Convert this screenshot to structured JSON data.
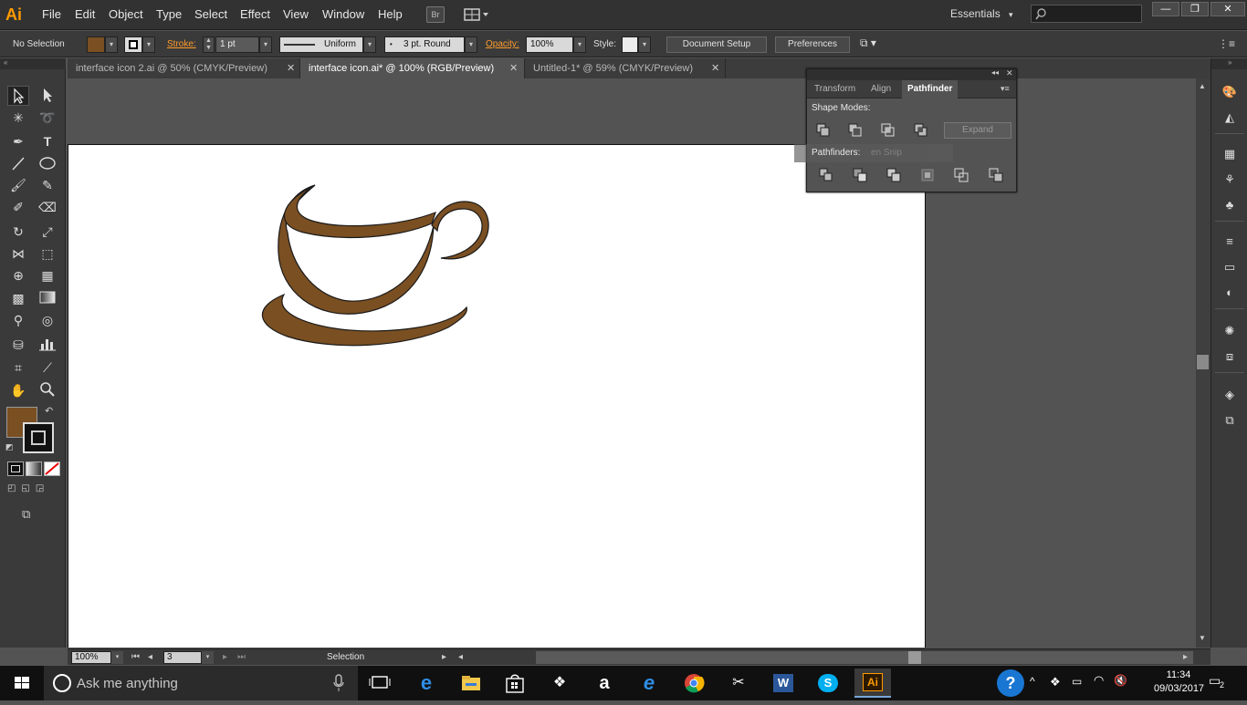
{
  "app": {
    "logo": "Ai"
  },
  "menu": [
    "File",
    "Edit",
    "Object",
    "Type",
    "Select",
    "Effect",
    "View",
    "Window",
    "Help"
  ],
  "bridge_label": "Br",
  "workspace": {
    "label": "Essentials",
    "arrow": "▾"
  },
  "window_controls": {
    "minimize": "—",
    "restore": "❐",
    "close": "✕"
  },
  "control_bar": {
    "selection": "No Selection",
    "fill_color": "#7a4f22",
    "stroke_label": "Stroke:",
    "stroke_weight": "1 pt",
    "profile": "Uniform",
    "brush": "3 pt. Round",
    "opacity_label": "Opacity:",
    "opacity": "100%",
    "style_label": "Style:",
    "document_setup": "Document Setup",
    "preferences": "Preferences"
  },
  "tabs": [
    {
      "label": "interface icon 2.ai @ 50% (CMYK/Preview)",
      "active": false
    },
    {
      "label": "interface icon.ai* @ 100% (RGB/Preview)",
      "active": true
    },
    {
      "label": "Untitled-1* @ 59% (CMYK/Preview)",
      "active": false
    }
  ],
  "tab_close": "✕",
  "pathfinder": {
    "tabs": [
      "Transform",
      "Align",
      "Pathfinder"
    ],
    "active_tab": "Pathfinder",
    "shape_modes_label": "Shape Modes:",
    "expand_label": "Expand",
    "pathfinders_label": "Pathfinders:",
    "overlay_text": "en Snip"
  },
  "statusbar": {
    "zoom": "100%",
    "artboard": "3",
    "tool": "Selection"
  },
  "artwork": {
    "fill": "#7a4f22",
    "stroke": "#1a1a1a"
  },
  "taskbar": {
    "search_placeholder": "Ask me anything",
    "time": "11:34",
    "date": "09/03/2017",
    "notifications": "2"
  }
}
